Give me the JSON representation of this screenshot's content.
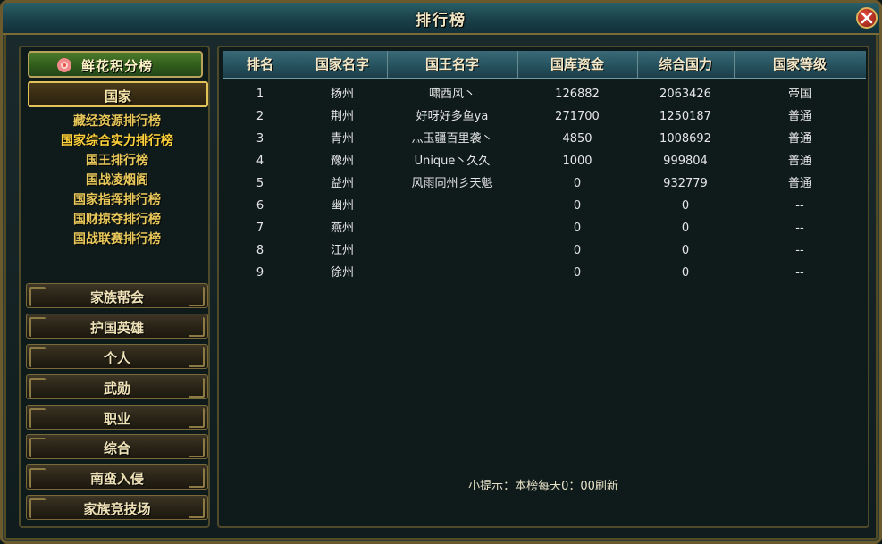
{
  "window": {
    "title": "排行榜"
  },
  "sidebar": {
    "flower_label": "鲜花积分榜",
    "country_label": "国家",
    "subitems": [
      {
        "label": "藏经资源排行榜",
        "active": false
      },
      {
        "label": "国家综合实力排行榜",
        "active": true
      },
      {
        "label": "国王排行榜",
        "active": false
      },
      {
        "label": "国战凌烟阁",
        "active": false
      },
      {
        "label": "国家指挥排行榜",
        "active": false
      },
      {
        "label": "国财掠夺排行榜",
        "active": false
      },
      {
        "label": "国战联赛排行榜",
        "active": false
      }
    ],
    "categories": [
      "家族帮会",
      "护国英雄",
      "个人",
      "武勋",
      "职业",
      "综合",
      "南蛮入侵",
      "家族竞技场"
    ]
  },
  "table": {
    "headers": [
      "排名",
      "国家名字",
      "国王名字",
      "国库资金",
      "综合国力",
      "国家等级"
    ],
    "rows": [
      [
        "1",
        "扬州",
        "啸西风丶",
        "126882",
        "2063426",
        "帝国"
      ],
      [
        "2",
        "荆州",
        "好呀好多鱼ya",
        "271700",
        "1250187",
        "普通"
      ],
      [
        "3",
        "青州",
        "灬玉疆百里袭丶",
        "4850",
        "1008692",
        "普通"
      ],
      [
        "4",
        "豫州",
        "Unique丶久久",
        "1000",
        "999804",
        "普通"
      ],
      [
        "5",
        "益州",
        "风雨同州彡天魁",
        "0",
        "932779",
        "普通"
      ],
      [
        "6",
        "幽州",
        "",
        "0",
        "0",
        "--"
      ],
      [
        "7",
        "燕州",
        "",
        "0",
        "0",
        "--"
      ],
      [
        "8",
        "江州",
        "",
        "0",
        "0",
        "--"
      ],
      [
        "9",
        "徐州",
        "",
        "0",
        "0",
        "--"
      ]
    ]
  },
  "hint": "小提示：本榜每天0：00刷新"
}
